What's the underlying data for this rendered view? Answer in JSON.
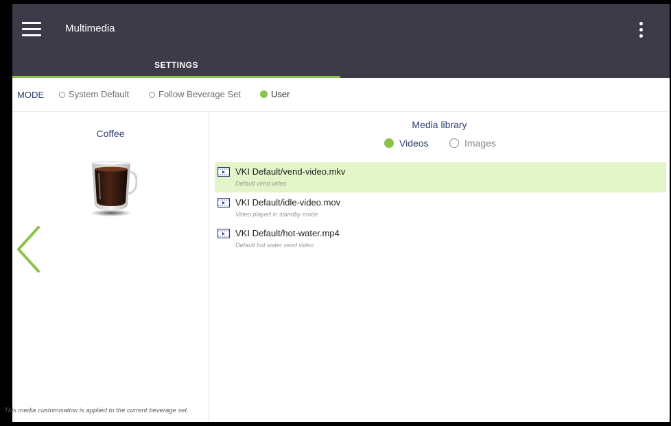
{
  "app": {
    "title": "Multimedia",
    "tabs": [
      {
        "label": "SETTINGS",
        "selected": true
      }
    ],
    "accent_color": "#8bc34a",
    "bar_color": "#3d3b48"
  },
  "mode": {
    "label": "MODE",
    "options": [
      {
        "label": "System Default",
        "selected": false
      },
      {
        "label": "Follow Beverage Set",
        "selected": false
      },
      {
        "label": "User",
        "selected": true
      }
    ]
  },
  "beverage": {
    "name": "Coffee",
    "image_icon": "coffee-cup-icon",
    "back_icon": "chevron-left-icon"
  },
  "library": {
    "title": "Media library",
    "filters": [
      {
        "label": "Videos",
        "selected": true
      },
      {
        "label": "Images",
        "selected": false
      }
    ],
    "items": [
      {
        "name": "VKI Default/vend-video.mkv",
        "description": "Default vend video",
        "selected": true
      },
      {
        "name": "VKI Default/idle-video.mov",
        "description": "Video played in standby mode",
        "selected": false
      },
      {
        "name": "VKI Default/hot-water.mp4",
        "description": "Default hot water vend video",
        "selected": false
      }
    ]
  },
  "footer": {
    "note": "This media customisation is applied to the current beverage set."
  }
}
